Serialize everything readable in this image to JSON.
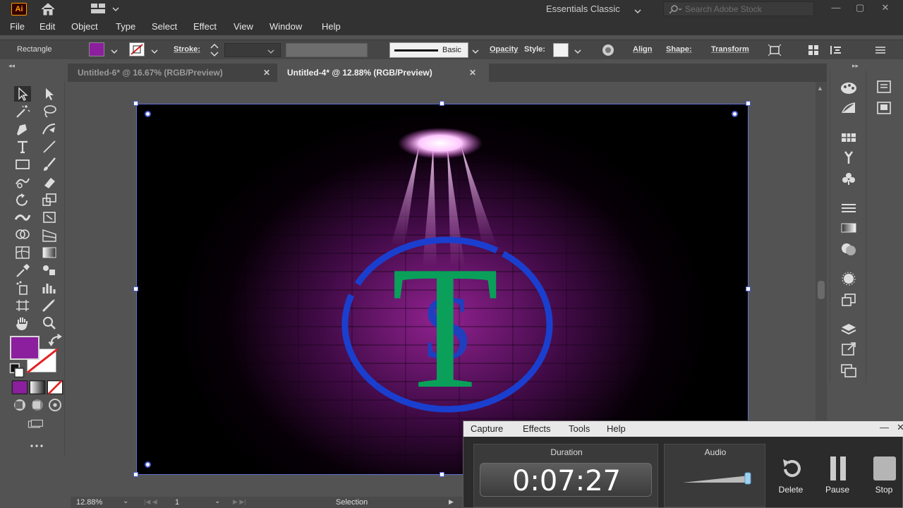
{
  "app": {
    "logo_text": "Ai",
    "workspace": "Essentials Classic",
    "stock_search_placeholder": "Search Adobe Stock"
  },
  "menu": [
    "File",
    "Edit",
    "Object",
    "Type",
    "Select",
    "Effect",
    "View",
    "Window",
    "Help"
  ],
  "control_bar": {
    "object_type": "Rectangle",
    "fill_color": "#8c1f9e",
    "stroke_label": "Stroke:",
    "brush_label": "Basic",
    "opacity_label": "Opacity",
    "style_label": "Style:",
    "align_label": "Align",
    "shape_label": "Shape:",
    "transform_label": "Transform"
  },
  "tabs": [
    {
      "label": "Untitled-6* @ 16.67% (RGB/Preview)",
      "active": false
    },
    {
      "label": "Untitled-4* @ 12.88% (RGB/Preview)",
      "active": true
    }
  ],
  "artwork": {
    "letter_big": "T",
    "letter_small": "S",
    "letter_big_color": "#0aa05a",
    "letter_small_color": "#1f3fbf",
    "ring_color": "#1a3fcf",
    "glow_color": "#b02ab8"
  },
  "status": {
    "zoom": "12.88%",
    "artboard": "1",
    "tool": "Selection"
  },
  "capture": {
    "menu": [
      "Capture",
      "Effects",
      "Tools",
      "Help"
    ],
    "duration_label": "Duration",
    "duration_time": "0:07:27",
    "audio_label": "Audio",
    "buttons": {
      "delete": "Delete",
      "pause": "Pause",
      "stop": "Stop"
    }
  }
}
